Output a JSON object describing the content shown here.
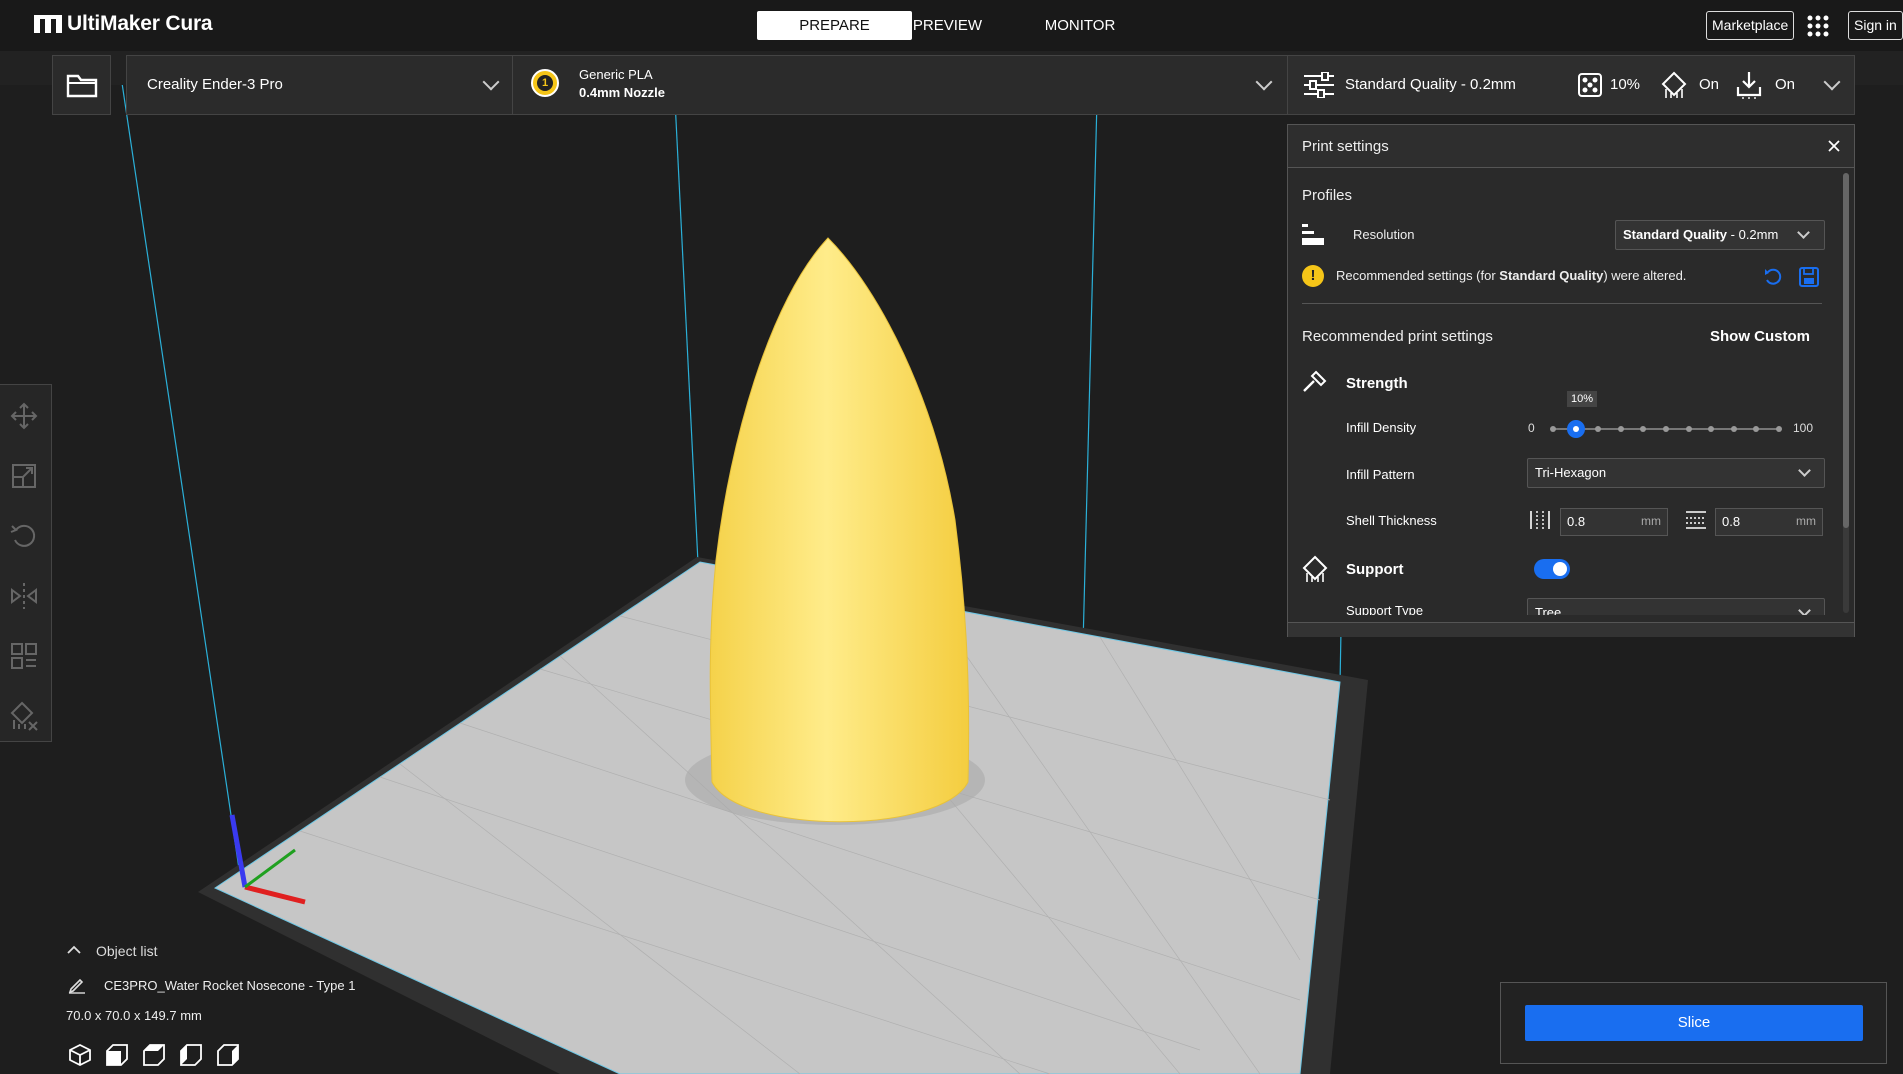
{
  "app": {
    "title": "UltiMaker Cura"
  },
  "tabs": [
    {
      "label": "PREPARE",
      "active": true
    },
    {
      "label": "PREVIEW",
      "active": false
    },
    {
      "label": "MONITOR",
      "active": false
    }
  ],
  "header_right": {
    "marketplace": "Marketplace",
    "signin": "Sign in"
  },
  "printer": {
    "name": "Creality Ender-3 Pro"
  },
  "material": {
    "extruder_number": "1",
    "name": "Generic PLA",
    "nozzle": "0.4mm Nozzle"
  },
  "quality_bar": {
    "profile": "Standard Quality - 0.2mm",
    "infill": "10%",
    "support": "On",
    "adhesion": "On"
  },
  "print_settings": {
    "title": "Print settings",
    "profiles_heading": "Profiles",
    "resolution_label": "Resolution",
    "resolution_value_bold": "Standard Quality",
    "resolution_value_rest": " - 0.2mm",
    "alert_pre": "Recommended settings (for ",
    "alert_bold": "Standard Quality",
    "alert_post": ") were altered.",
    "recommended_heading": "Recommended print settings",
    "show_custom": "Show Custom",
    "strength_heading": "Strength",
    "infill_density_label": "Infill Density",
    "infill_density_value": "10%",
    "slider_min": "0",
    "slider_max": "100",
    "infill_fraction": 0.1,
    "infill_pattern_label": "Infill Pattern",
    "infill_pattern_value": "Tri-Hexagon",
    "shell_thickness_label": "Shell Thickness",
    "wall_thickness_value": "0.8",
    "topbottom_thickness_value": "0.8",
    "unit_mm": "mm",
    "support_heading": "Support",
    "support_enabled": true,
    "support_type_label": "Support Type",
    "support_type_value": "Tree"
  },
  "object_list": {
    "label": "Object list",
    "object_name": "CE3PRO_Water Rocket Nosecone - Type 1",
    "dimensions": "70.0 x 70.0 x 149.7 mm"
  },
  "slice": {
    "label": "Slice"
  },
  "colors": {
    "accent": "#196ef0",
    "model": "#ffe066",
    "background": "#1e1e1e",
    "warning": "#f5c518"
  },
  "icons": [
    "open-folder-icon",
    "move-icon",
    "scale-icon",
    "rotate-icon",
    "mirror-icon",
    "per-model-settings-icon",
    "support-blocker-icon",
    "view-3d-icon",
    "view-front-icon",
    "view-top-icon",
    "view-left-icon",
    "view-right-icon"
  ]
}
